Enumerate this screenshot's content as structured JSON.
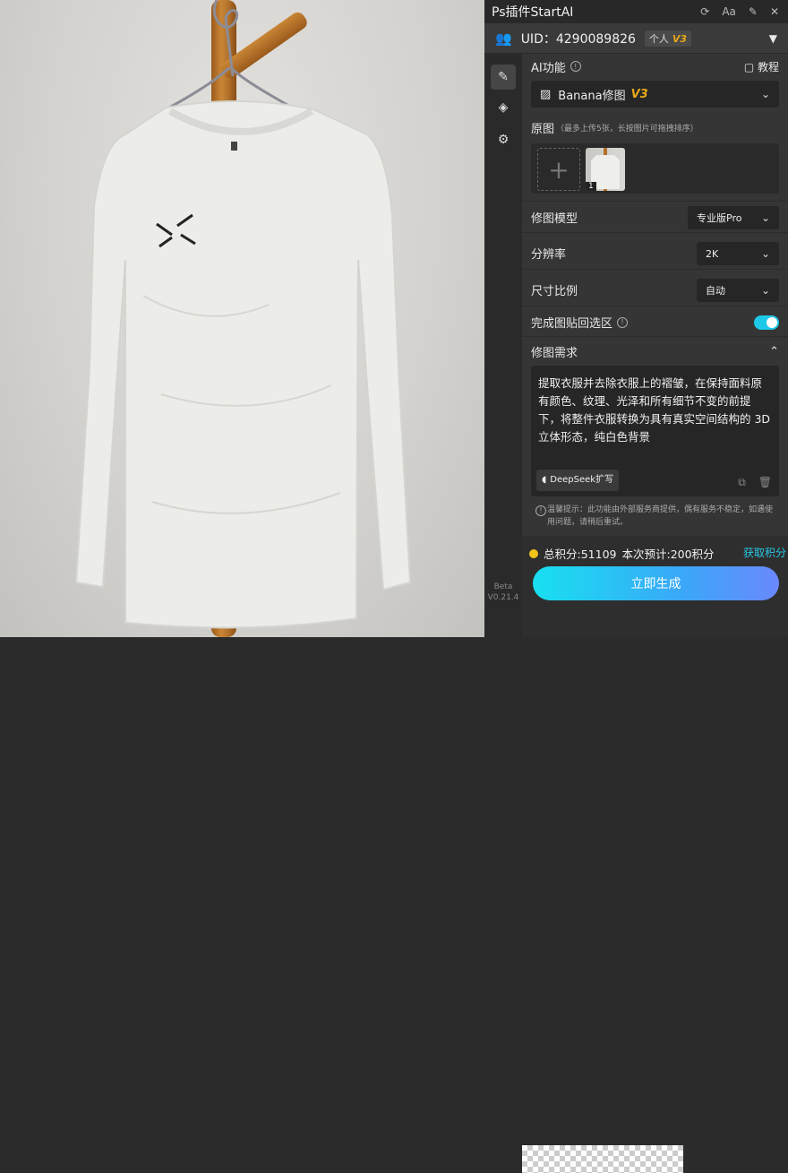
{
  "titlebar": {
    "title": "Ps插件StartAI",
    "icons": [
      "refresh-icon",
      "font-size-icon",
      "pin-icon",
      "close-icon"
    ],
    "font_label": "Aa"
  },
  "user": {
    "uid_label": "UID：4290089826",
    "plan": "个人",
    "plan_version": "V3"
  },
  "sidenav": {
    "items": [
      "edit-icon",
      "layers-icon",
      "gear-icon"
    ],
    "beta_label": "Beta",
    "version": "V0.21.4"
  },
  "ai_function": {
    "label": "AI功能",
    "tutorial": "教程",
    "selected": "Banana修图",
    "selected_version": "V3"
  },
  "source": {
    "label": "原图",
    "hint": "（最多上传5张，长按图片可拖拽排序）",
    "image_count_badge": "1"
  },
  "model": {
    "label": "修图模型",
    "value": "专业版Pro"
  },
  "resolution": {
    "label": "分辨率",
    "value": "2K"
  },
  "ratio": {
    "label": "尺寸比例",
    "value": "自动"
  },
  "paste_back": {
    "label": "完成图贴回选区",
    "enabled": true
  },
  "request": {
    "label": "修图需求",
    "text": "提取衣服并去除衣服上的褶皱，在保持面料原有颜色、纹理、光泽和所有细节不变的前提下，将整件衣服转换为具有真实空间结构的 3D 立体形态，纯白色背景",
    "deepseek_label": "DeepSeek扩写"
  },
  "notice": "温馨提示：此功能由外部服务商提供，偶有服务不稳定，如遇使用问题，请稍后重试。",
  "footer": {
    "total_points": "总积分:51109",
    "estimate": "本次预计:200积分",
    "get_points": "获取积分",
    "generate": "立即生成"
  },
  "colors": {
    "accent": "#1ec8e8",
    "version_badge": "#e8a818",
    "coin": "#f2c418"
  }
}
